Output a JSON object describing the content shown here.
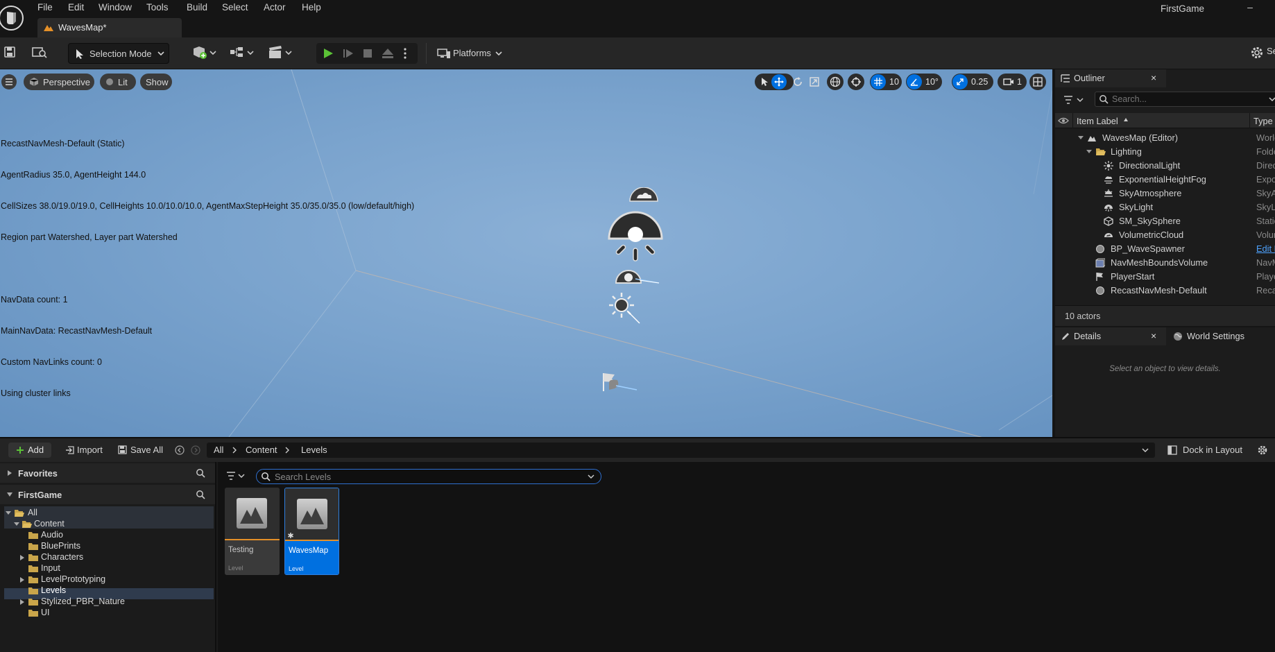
{
  "menu": {
    "items": [
      "File",
      "Edit",
      "Window",
      "Tools",
      "Build",
      "Select",
      "Actor",
      "Help"
    ],
    "app_title": "FirstGame",
    "minimize": "–"
  },
  "level_tab": {
    "label": "WavesMap*"
  },
  "toolbar": {
    "selection_mode": "Selection Mode",
    "platforms": "Platforms",
    "settings_partial": "Se"
  },
  "viewport": {
    "menu_icon": "hamburger-icon",
    "perspective": "Perspective",
    "lit": "Lit",
    "show": "Show",
    "grid_snap": "10",
    "rotation_snap": "10°",
    "scale_snap": "0.25",
    "camera_speed": "1",
    "nav_info": [
      "RecastNavMesh-Default (Static)",
      "AgentRadius 35.0, AgentHeight 144.0",
      "CellSizes 38.0/19.0/19.0, CellHeights 10.0/10.0/10.0, AgentMaxStepHeight 35.0/35.0/35.0 (low/default/high)",
      "Region part Watershed, Layer part Watershed",
      "",
      "NavData count: 1",
      "MainNavData: RecastNavMesh-Default",
      "Custom NavLinks count: 0",
      "Using cluster links"
    ],
    "background_color": "#7aa3cd"
  },
  "outliner": {
    "tab_label": "Outliner",
    "search_placeholder": "Search...",
    "col_label": "Item Label",
    "col_type": "Type",
    "rows": [
      {
        "label": "WavesMap (Editor)",
        "type": "World"
      },
      {
        "label": "Lighting",
        "type": "Folder"
      },
      {
        "label": "DirectionalLight",
        "type": "Direc"
      },
      {
        "label": "ExponentialHeightFog",
        "type": "Expo"
      },
      {
        "label": "SkyAtmosphere",
        "type": "SkyA"
      },
      {
        "label": "SkyLight",
        "type": "SkyL"
      },
      {
        "label": "SM_SkySphere",
        "type": "Static"
      },
      {
        "label": "VolumetricCloud",
        "type": "Volum"
      },
      {
        "label": "BP_WaveSpawner",
        "type": "Edit B"
      },
      {
        "label": "NavMeshBoundsVolume",
        "type": "NavM"
      },
      {
        "label": "PlayerStart",
        "type": "Playe"
      },
      {
        "label": "RecastNavMesh-Default",
        "type": "Reca"
      }
    ],
    "count": "10 actors"
  },
  "details": {
    "tab_label": "Details",
    "world_settings": "World Settings",
    "empty_message": "Select an object to view details."
  },
  "content_browser": {
    "add": "Add",
    "import": "Import",
    "save_all": "Save All",
    "path": [
      "All",
      "Content",
      "Levels"
    ],
    "dock": "Dock in Layout",
    "favorites": "Favorites",
    "project": "FirstGame",
    "tree": [
      "All",
      "Content",
      "Audio",
      "BluePrints",
      "Characters",
      "Input",
      "LevelPrototyping",
      "Levels",
      "Stylized_PBR_Nature",
      "UI"
    ],
    "search_placeholder": "Search Levels",
    "assets": [
      {
        "name": "Testing",
        "type": "Level"
      },
      {
        "name": "WavesMap",
        "type": "Level"
      }
    ]
  },
  "colors": {
    "accent": "#0070e0",
    "play_green": "#5bc236",
    "folder": "#c9a54a",
    "level_underline": "#e59028"
  }
}
